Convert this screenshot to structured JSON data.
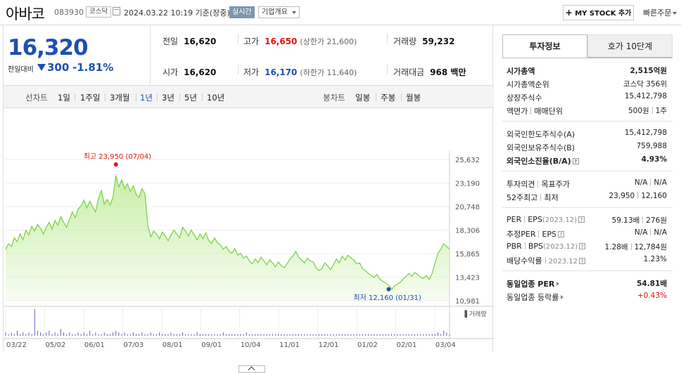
{
  "header": {
    "stock_name": "아바코",
    "stock_code": "083930",
    "market": "코스닥",
    "timestamp": "2024.03.22 10:19 기준(장중)",
    "live_badge": "실시간",
    "company_info_btn": "기업개요",
    "mystock_btn": "MY STOCK 추가",
    "quick_order_btn": "빠른주문"
  },
  "price": {
    "current": "16,320",
    "change_label": "전일대비",
    "change_value": "300",
    "change_rate": "-1.81%",
    "direction": "down"
  },
  "quote": {
    "prev_close_label": "전일",
    "prev_close": "16,620",
    "high_label": "고가",
    "high": "16,650",
    "upper_limit": "(상한가 21,600)",
    "volume_label": "거래량",
    "volume": "59,232",
    "open_label": "시가",
    "open": "16,620",
    "low_label": "저가",
    "low": "16,170",
    "lower_limit": "(하한가 11,640)",
    "amount_label": "거래대금",
    "amount": "968 백만"
  },
  "tabs": {
    "line_label": "선차트",
    "line_periods": [
      "1일",
      "1주일",
      "3개월",
      "1년",
      "3년",
      "5년",
      "10년"
    ],
    "active_period": "1년",
    "candle_label": "봉차트",
    "candle_periods": [
      "일봉",
      "주봉",
      "월봉"
    ]
  },
  "chart_data": {
    "type": "area",
    "x_tick_labels": [
      "03/22",
      "05/02",
      "06/01",
      "07/03",
      "08/01",
      "09/01",
      "10/04",
      "11/01",
      "12/01",
      "01/02",
      "02/01",
      "03/04"
    ],
    "y_tick_labels": [
      "25,632",
      "23,190",
      "20,748",
      "18,306",
      "15,865",
      "13,423",
      "10,981"
    ],
    "ylim": [
      10981,
      25632
    ],
    "values": [
      16300,
      16900,
      16600,
      17500,
      17100,
      17900,
      17300,
      18300,
      17800,
      18700,
      18200,
      18900,
      18500,
      17900,
      18600,
      19100,
      18400,
      19300,
      18800,
      19700,
      19100,
      18600,
      19400,
      20200,
      19600,
      20500,
      20800,
      21400,
      20600,
      21300,
      20700,
      20200,
      21600,
      22400,
      21000,
      21500,
      20900,
      21700,
      23950,
      22800,
      23500,
      22600,
      23100,
      22300,
      22900,
      22000,
      21700,
      22600,
      22100,
      18800,
      17600,
      18200,
      17900,
      17400,
      18100,
      17700,
      17200,
      17800,
      18300,
      17900,
      17500,
      18600,
      18200,
      17700,
      18300,
      17800,
      17300,
      17900,
      17400,
      18000,
      17200,
      16900,
      17500,
      17000,
      16800,
      16300,
      16600,
      16100,
      15900,
      16400,
      15700,
      15900,
      15400,
      15600,
      15100,
      14800,
      15300,
      14900,
      15500,
      15100,
      14700,
      15200,
      14900,
      14500,
      15000,
      14600,
      14400,
      14800,
      15300,
      15600,
      16100,
      15500,
      15200,
      14900,
      15400,
      15100,
      15000,
      14400,
      14100,
      14300,
      14900,
      14600,
      14200,
      14700,
      15300,
      14900,
      15600,
      15200,
      15700,
      15400,
      15200,
      14800,
      14900,
      14300,
      14100,
      13800,
      13600,
      13400,
      13700,
      13200,
      13000,
      12800,
      12600,
      12160,
      12500,
      12700,
      12900,
      13200,
      13500,
      13800,
      13500,
      13900,
      13700,
      13400,
      13300,
      13600,
      13200,
      13800,
      14900,
      15900,
      16300,
      16900,
      16600,
      16320
    ],
    "min_index": 132,
    "max_index": 38,
    "volumes": [
      2,
      1,
      2,
      1,
      3,
      1,
      2,
      1,
      2,
      1,
      16,
      3,
      2,
      1,
      2,
      3,
      1,
      2,
      1,
      4,
      2,
      1,
      2,
      1,
      1,
      2,
      1,
      2,
      1,
      3,
      1,
      2,
      1,
      1,
      2,
      1,
      1,
      2,
      3,
      2,
      1,
      2,
      1,
      1,
      2,
      1,
      1,
      2,
      1,
      1,
      2,
      1,
      1,
      2,
      1,
      1,
      1,
      2,
      1,
      1,
      1,
      2,
      1,
      1,
      1,
      1,
      2,
      1,
      1,
      1,
      1,
      1,
      1,
      1,
      1,
      2,
      1,
      1,
      1,
      1,
      1,
      1,
      1,
      2,
      1,
      1,
      1,
      1,
      1,
      1,
      1,
      1,
      1,
      1,
      1,
      1,
      1,
      1,
      1,
      1,
      1,
      1,
      1,
      1,
      1,
      1,
      1,
      1,
      1,
      1,
      1,
      1,
      1,
      1,
      1,
      1,
      1,
      1,
      1,
      1,
      1,
      1,
      1,
      1,
      1,
      1,
      1,
      1,
      1,
      1,
      1,
      1,
      1,
      1,
      1,
      1,
      1,
      1,
      1,
      1,
      1,
      1,
      1,
      1,
      1,
      1,
      1,
      1,
      1,
      2,
      1,
      3,
      2,
      1
    ],
    "high_annotation": "최고 23,950 (07/04)",
    "low_annotation": "최저 12,160 (01/31)",
    "volume_label": "거래량",
    "line_color": "#7ed24a",
    "fill_color": "#c8efa8",
    "volume_color": "#5b63b5"
  },
  "side": {
    "tab_active": "투자정보",
    "tab_inactive": "호가 10단계",
    "market_cap_label": "시가총액",
    "market_cap": "2,515억원",
    "market_cap_rank_label": "시가총액순위",
    "market_cap_rank": "코스닥 356위",
    "shares_label": "상장주식수",
    "shares": "15,412,798",
    "par_label": "액면가",
    "unit_label": "매매단위",
    "par": "500원",
    "unit": "1주",
    "foreign_limit_label": "외국인한도주식수(A)",
    "foreign_limit": "15,412,798",
    "foreign_hold_label": "외국인보유주식수(B)",
    "foreign_hold": "759,988",
    "foreign_ratio_label": "외국인소진율(B/A)",
    "foreign_ratio": "4.93%",
    "opinion_label": "투자의견",
    "target_label": "목표주가",
    "opinion": "N/A",
    "target": "N/A",
    "w52_high_label": "52주최고",
    "w52_low_label": "최저",
    "w52_high": "23,950",
    "w52_low": "12,160",
    "per_label": "PER",
    "eps_label": "EPS",
    "eps_year": "(2023.12)",
    "per": "59.13배",
    "eps": "276원",
    "est_per_label": "추정PER",
    "est_eps_label": "EPS",
    "est_per": "N/A",
    "est_eps": "N/A",
    "pbr_label": "PBR",
    "bps_label": "BPS",
    "bps_year": "(2023.12)",
    "pbr": "1.28배",
    "bps": "12,784원",
    "div_label": "배당수익률",
    "div_year": "2023.12",
    "div": "1.23%",
    "sector_per_label": "동일업종 PER",
    "sector_per": "54.81배",
    "sector_change_label": "동일업종 등락률",
    "sector_change": "+0.43%"
  }
}
